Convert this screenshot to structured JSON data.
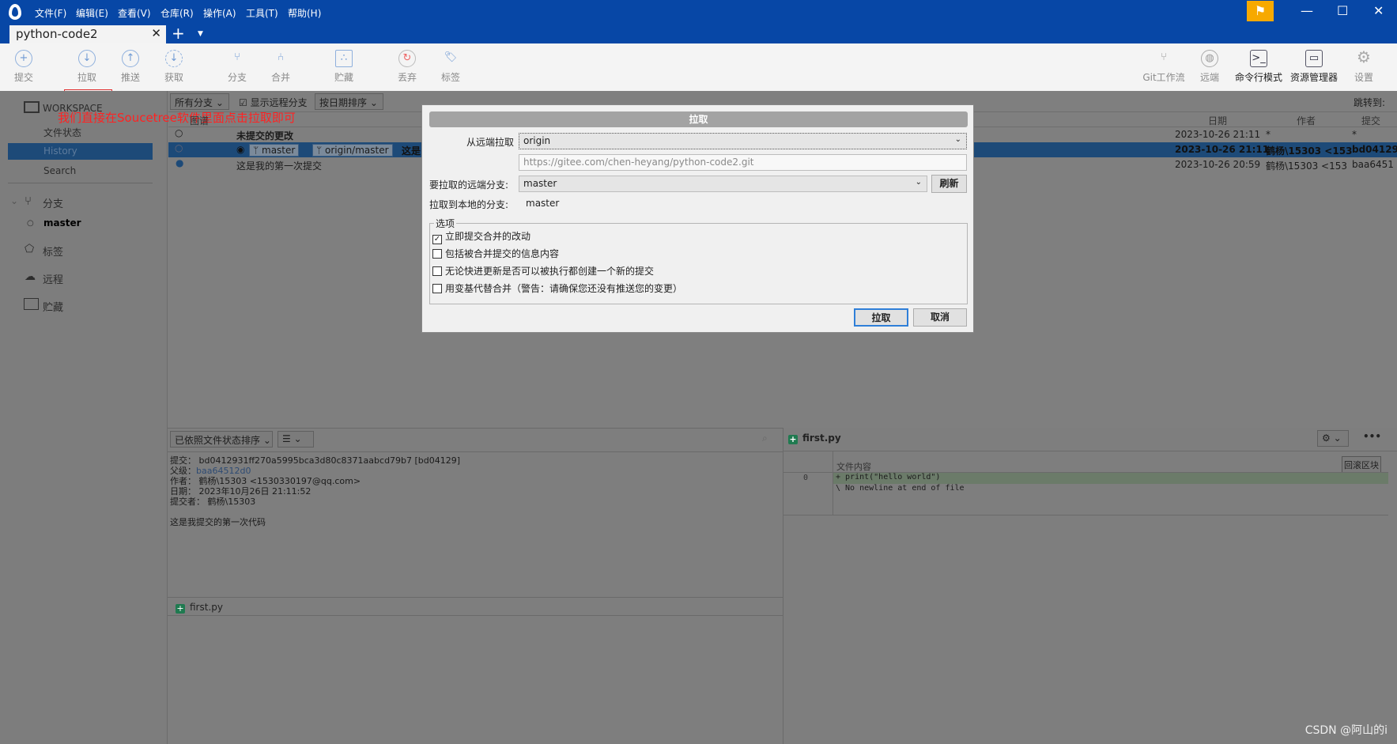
{
  "app": {
    "menu": [
      "文件(F)",
      "编辑(E)",
      "查看(V)",
      "仓库(R)",
      "操作(A)",
      "工具(T)",
      "帮助(H)"
    ],
    "tab": "python-code2"
  },
  "toolbar": {
    "left": [
      {
        "label": "提交",
        "icon": "plus-circle-icon"
      },
      {
        "label": "拉取",
        "icon": "arrow-down-circle-icon"
      },
      {
        "label": "推送",
        "icon": "arrow-up-circle-icon"
      },
      {
        "label": "获取",
        "icon": "fetch-icon"
      },
      {
        "label": "分支",
        "icon": "branch-icon"
      },
      {
        "label": "合并",
        "icon": "merge-icon"
      },
      {
        "label": "贮藏",
        "icon": "stash-icon"
      },
      {
        "label": "丢弃",
        "icon": "discard-icon"
      },
      {
        "label": "标签",
        "icon": "tag-icon"
      }
    ],
    "right": [
      {
        "label": "Git工作流",
        "icon": "git-flow-icon"
      },
      {
        "label": "远端",
        "icon": "globe-icon"
      },
      {
        "label": "命令行模式",
        "icon": "terminal-icon"
      },
      {
        "label": "资源管理器",
        "icon": "folder-icon"
      },
      {
        "label": "设置",
        "icon": "gear-icon"
      }
    ]
  },
  "annotation": "我们直接在Soucetree软件里面点击拉取即可",
  "sidebar": {
    "workspace": "WORKSPACE",
    "items": [
      "文件状态",
      "History",
      "Search"
    ],
    "branches": "分支",
    "branch_master": "master",
    "tags": "标签",
    "remotes": "远程",
    "stashes": "贮藏"
  },
  "filters": {
    "branches": "所有分支",
    "show_remote": "显示远程分支",
    "sort": "按日期排序",
    "jump": "跳转到:"
  },
  "columns": {
    "graph": "图谱",
    "date": "日期",
    "author": "作者",
    "commit": "提交"
  },
  "commits": [
    {
      "desc": "未提交的更改",
      "date": "2023-10-26 21:11",
      "author": "*",
      "hash": "*"
    },
    {
      "desc": "这是",
      "branch": "master",
      "remote": "origin/master",
      "date": "2023-10-26 21:11",
      "author": "鹤杨\\15303 <153",
      "hash": "bd04129"
    },
    {
      "desc": "这是我的第一次提交",
      "date": "2023-10-26 20:59",
      "author": "鹤杨\\15303 <153",
      "hash": "baa6451"
    }
  ],
  "dialog": {
    "title": "拉取",
    "remote_label": "从远端拉取",
    "remote": "origin",
    "url": "https://gitee.com/chen-heyang/python-code2.git",
    "remote_branch_label": "要拉取的远端分支:",
    "remote_branch": "master",
    "refresh": "刷新",
    "local_branch_label": "拉取到本地的分支:",
    "local_branch": "master",
    "options_label": "选项",
    "options": [
      {
        "label": "立即提交合并的改动",
        "checked": true
      },
      {
        "label": "包括被合并提交的信息内容",
        "checked": false
      },
      {
        "label": "无论快进更新是否可以被执行都创建一个新的提交",
        "checked": false
      },
      {
        "label": "用变基代替合并（警告：请确保您还没有推送您的变更）",
        "checked": false
      }
    ],
    "ok": "拉取",
    "cancel": "取消"
  },
  "details": {
    "sort": "已依照文件状态排序",
    "commit": "提交： bd0412931ff270a5995bca3d80c8371aabcd79b7 [bd04129]",
    "parent_label": "父级：",
    "parent": "baa64512d0",
    "author": "作者： 鹤杨\\15303 <1530330197@qq.com>",
    "date": "日期： 2023年10月26日 21:11:52",
    "committer": "提交者： 鹤杨\\15303",
    "message": "这是我提交的第一次代码",
    "file": "first.py"
  },
  "diff": {
    "file": "first.py",
    "header": "文件内容",
    "revert": "回滚区块",
    "line_no": "0",
    "lines": [
      "+ print(\"hello world\")",
      "\\  No newline at end of file"
    ]
  },
  "watermark": "CSDN @阿山的i"
}
